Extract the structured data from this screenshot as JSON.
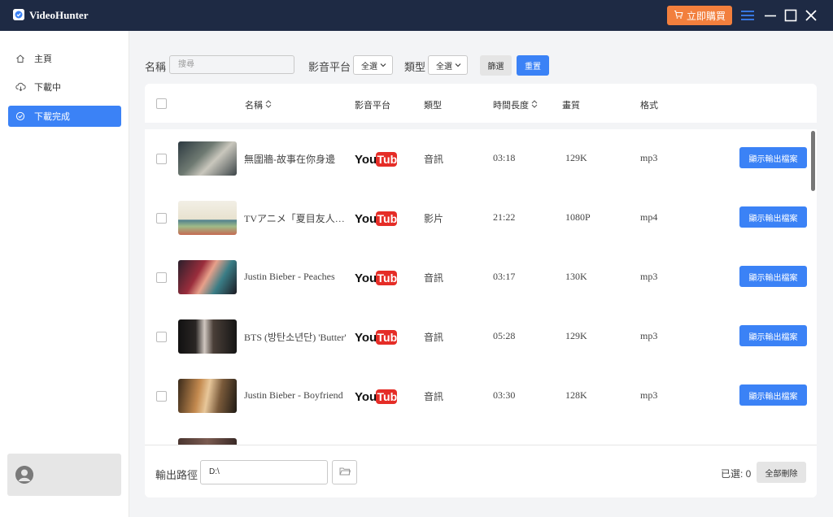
{
  "app": {
    "title": "VideoHunter",
    "buy_label": "立即購買"
  },
  "sidebar": {
    "items": [
      {
        "label": "主頁",
        "icon": "home-icon"
      },
      {
        "label": "下載中",
        "icon": "cloud-download-icon"
      },
      {
        "label": "下載完成",
        "icon": "check-circle-icon",
        "active": true
      }
    ]
  },
  "filters": {
    "name_label": "名稱",
    "search_placeholder": "搜尋",
    "platform_label": "影音平台",
    "platform_value": "全選",
    "type_label": "類型",
    "type_value": "全選",
    "filter_button": "篩選",
    "reset_button": "重置"
  },
  "table": {
    "columns": {
      "name": "名稱",
      "platform": "影音平台",
      "type": "類型",
      "duration": "時間長度",
      "quality": "畫質",
      "format": "格式"
    },
    "show_output_label": "顯示輸出檔案",
    "platform_logo_text": {
      "you": "You",
      "tube": "Tube"
    },
    "rows": [
      {
        "title": "無圍牆-故事在你身邊",
        "type": "音訊",
        "duration": "03:18",
        "quality": "129K",
        "format": "mp3"
      },
      {
        "title": "TVアニメ「夏目友人帳」",
        "type": "影片",
        "duration": "21:22",
        "quality": "1080P",
        "format": "mp4"
      },
      {
        "title": "Justin Bieber - Peaches",
        "type": "音訊",
        "duration": "03:17",
        "quality": "130K",
        "format": "mp3"
      },
      {
        "title": "BTS (방탄소년단) 'Butter'",
        "type": "音訊",
        "duration": "05:28",
        "quality": "129K",
        "format": "mp3"
      },
      {
        "title": "Justin Bieber - Boyfriend",
        "type": "音訊",
        "duration": "03:30",
        "quality": "128K",
        "format": "mp3"
      }
    ]
  },
  "footer": {
    "output_label": "輸出路徑",
    "output_path": "D:\\",
    "selected_label": "已選: 0",
    "delete_all": "全部刪除"
  },
  "colors": {
    "titlebar": "#1e2a44",
    "accent": "#3b82f6",
    "buy": "#f27f3d",
    "youtube_red": "#e52d27"
  }
}
